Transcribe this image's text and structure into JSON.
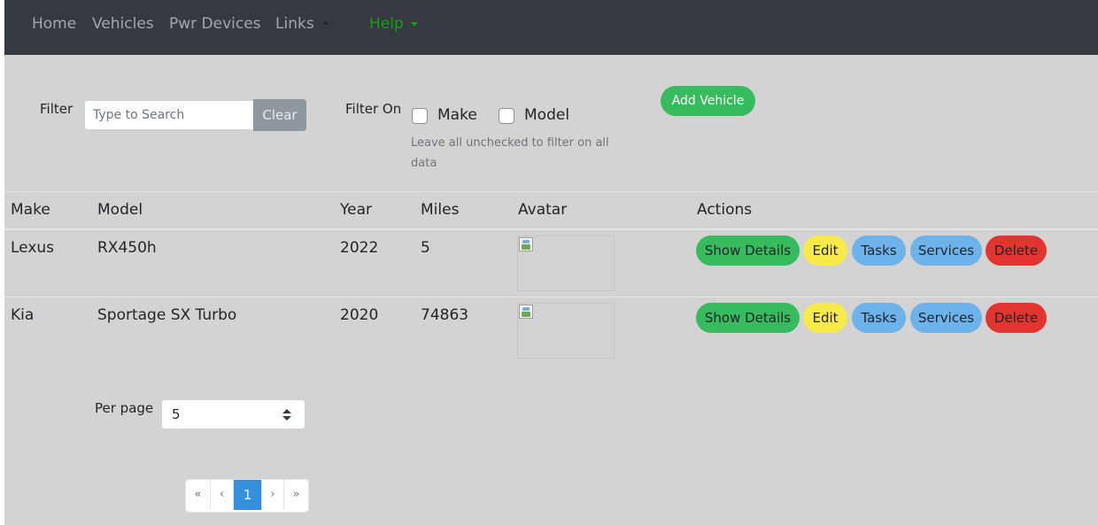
{
  "nav": {
    "items": [
      "Home",
      "Vehicles",
      "Pwr Devices",
      "Links"
    ],
    "help": "Help"
  },
  "filter": {
    "label": "Filter",
    "placeholder": "Type to Search",
    "clear": "Clear",
    "filter_on": "Filter On",
    "options": [
      "Make",
      "Model"
    ],
    "hint": "Leave all unchecked to filter on all data"
  },
  "add_vehicle": "Add Vehicle",
  "table": {
    "headers": [
      "Make",
      "Model",
      "Year",
      "Miles",
      "Avatar",
      "Actions"
    ],
    "rows": [
      {
        "make": "Lexus",
        "model": "RX450h",
        "year": "2022",
        "miles": "5"
      },
      {
        "make": "Kia",
        "model": "Sportage SX Turbo",
        "year": "2020",
        "miles": "74863"
      }
    ],
    "actions": [
      "Show Details",
      "Edit",
      "Tasks",
      "Services",
      "Delete"
    ]
  },
  "per_page": {
    "label": "Per page",
    "value": "5"
  },
  "pagination": {
    "first": "«",
    "prev": "‹",
    "current": "1",
    "next": "›",
    "last": "»"
  },
  "colors": {
    "navbar": "#343a40",
    "background": "#d3d3d3",
    "success": "#37bb5e",
    "warning": "#f8ea4a",
    "info": "#6cb2eb",
    "danger": "#e3342f",
    "help_link": "#16a016",
    "primary": "#3490dc"
  }
}
